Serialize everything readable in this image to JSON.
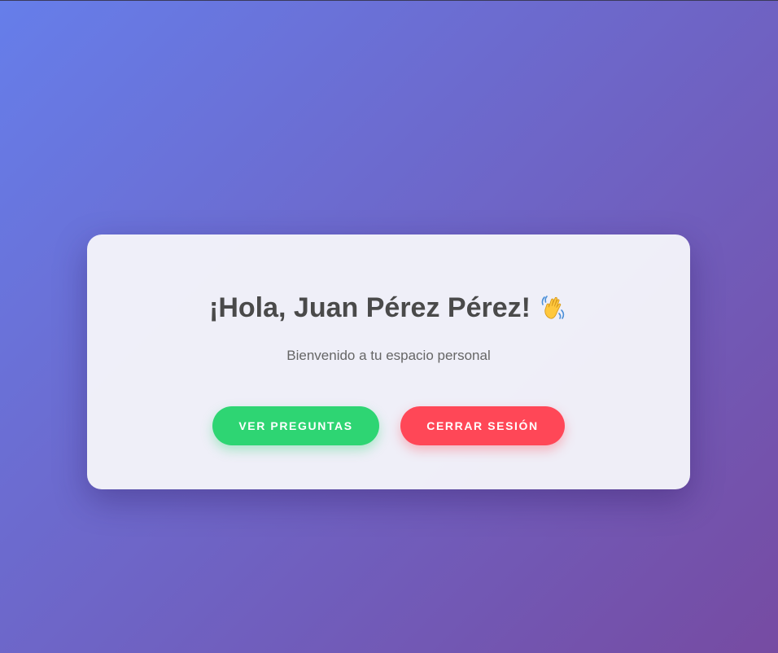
{
  "greeting": {
    "title": "¡Hola, Juan Pérez Pérez!",
    "emoji_icon": "waving-hand-icon",
    "subtitle": "Bienvenido a tu espacio personal"
  },
  "actions": {
    "questions_label": "VER PREGUNTAS",
    "logout_label": "CERRAR SESIÓN"
  },
  "colors": {
    "background_start": "#667eea",
    "background_end": "#764ba2",
    "questions_button": "#2ed573",
    "logout_button": "#ff4757",
    "card": "#f4f4f9",
    "title_text": "#4a4a4a"
  }
}
